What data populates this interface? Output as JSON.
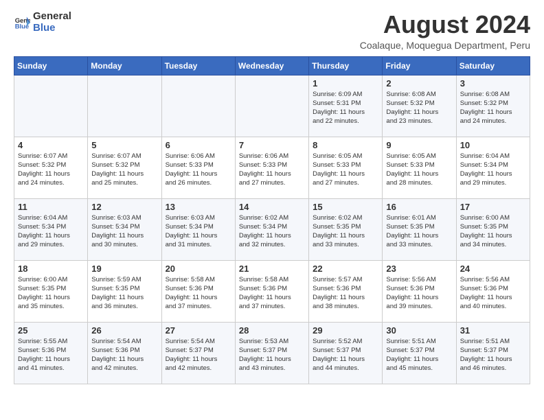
{
  "header": {
    "logo_general": "General",
    "logo_blue": "Blue",
    "title": "August 2024",
    "subtitle": "Coalaque, Moquegua Department, Peru"
  },
  "calendar": {
    "days_of_week": [
      "Sunday",
      "Monday",
      "Tuesday",
      "Wednesday",
      "Thursday",
      "Friday",
      "Saturday"
    ],
    "weeks": [
      [
        {
          "day": "",
          "info": ""
        },
        {
          "day": "",
          "info": ""
        },
        {
          "day": "",
          "info": ""
        },
        {
          "day": "",
          "info": ""
        },
        {
          "day": "1",
          "info": "Sunrise: 6:09 AM\nSunset: 5:31 PM\nDaylight: 11 hours\nand 22 minutes."
        },
        {
          "day": "2",
          "info": "Sunrise: 6:08 AM\nSunset: 5:32 PM\nDaylight: 11 hours\nand 23 minutes."
        },
        {
          "day": "3",
          "info": "Sunrise: 6:08 AM\nSunset: 5:32 PM\nDaylight: 11 hours\nand 24 minutes."
        }
      ],
      [
        {
          "day": "4",
          "info": "Sunrise: 6:07 AM\nSunset: 5:32 PM\nDaylight: 11 hours\nand 24 minutes."
        },
        {
          "day": "5",
          "info": "Sunrise: 6:07 AM\nSunset: 5:32 PM\nDaylight: 11 hours\nand 25 minutes."
        },
        {
          "day": "6",
          "info": "Sunrise: 6:06 AM\nSunset: 5:33 PM\nDaylight: 11 hours\nand 26 minutes."
        },
        {
          "day": "7",
          "info": "Sunrise: 6:06 AM\nSunset: 5:33 PM\nDaylight: 11 hours\nand 27 minutes."
        },
        {
          "day": "8",
          "info": "Sunrise: 6:05 AM\nSunset: 5:33 PM\nDaylight: 11 hours\nand 27 minutes."
        },
        {
          "day": "9",
          "info": "Sunrise: 6:05 AM\nSunset: 5:33 PM\nDaylight: 11 hours\nand 28 minutes."
        },
        {
          "day": "10",
          "info": "Sunrise: 6:04 AM\nSunset: 5:34 PM\nDaylight: 11 hours\nand 29 minutes."
        }
      ],
      [
        {
          "day": "11",
          "info": "Sunrise: 6:04 AM\nSunset: 5:34 PM\nDaylight: 11 hours\nand 29 minutes."
        },
        {
          "day": "12",
          "info": "Sunrise: 6:03 AM\nSunset: 5:34 PM\nDaylight: 11 hours\nand 30 minutes."
        },
        {
          "day": "13",
          "info": "Sunrise: 6:03 AM\nSunset: 5:34 PM\nDaylight: 11 hours\nand 31 minutes."
        },
        {
          "day": "14",
          "info": "Sunrise: 6:02 AM\nSunset: 5:34 PM\nDaylight: 11 hours\nand 32 minutes."
        },
        {
          "day": "15",
          "info": "Sunrise: 6:02 AM\nSunset: 5:35 PM\nDaylight: 11 hours\nand 33 minutes."
        },
        {
          "day": "16",
          "info": "Sunrise: 6:01 AM\nSunset: 5:35 PM\nDaylight: 11 hours\nand 33 minutes."
        },
        {
          "day": "17",
          "info": "Sunrise: 6:00 AM\nSunset: 5:35 PM\nDaylight: 11 hours\nand 34 minutes."
        }
      ],
      [
        {
          "day": "18",
          "info": "Sunrise: 6:00 AM\nSunset: 5:35 PM\nDaylight: 11 hours\nand 35 minutes."
        },
        {
          "day": "19",
          "info": "Sunrise: 5:59 AM\nSunset: 5:35 PM\nDaylight: 11 hours\nand 36 minutes."
        },
        {
          "day": "20",
          "info": "Sunrise: 5:58 AM\nSunset: 5:36 PM\nDaylight: 11 hours\nand 37 minutes."
        },
        {
          "day": "21",
          "info": "Sunrise: 5:58 AM\nSunset: 5:36 PM\nDaylight: 11 hours\nand 37 minutes."
        },
        {
          "day": "22",
          "info": "Sunrise: 5:57 AM\nSunset: 5:36 PM\nDaylight: 11 hours\nand 38 minutes."
        },
        {
          "day": "23",
          "info": "Sunrise: 5:56 AM\nSunset: 5:36 PM\nDaylight: 11 hours\nand 39 minutes."
        },
        {
          "day": "24",
          "info": "Sunrise: 5:56 AM\nSunset: 5:36 PM\nDaylight: 11 hours\nand 40 minutes."
        }
      ],
      [
        {
          "day": "25",
          "info": "Sunrise: 5:55 AM\nSunset: 5:36 PM\nDaylight: 11 hours\nand 41 minutes."
        },
        {
          "day": "26",
          "info": "Sunrise: 5:54 AM\nSunset: 5:36 PM\nDaylight: 11 hours\nand 42 minutes."
        },
        {
          "day": "27",
          "info": "Sunrise: 5:54 AM\nSunset: 5:37 PM\nDaylight: 11 hours\nand 42 minutes."
        },
        {
          "day": "28",
          "info": "Sunrise: 5:53 AM\nSunset: 5:37 PM\nDaylight: 11 hours\nand 43 minutes."
        },
        {
          "day": "29",
          "info": "Sunrise: 5:52 AM\nSunset: 5:37 PM\nDaylight: 11 hours\nand 44 minutes."
        },
        {
          "day": "30",
          "info": "Sunrise: 5:51 AM\nSunset: 5:37 PM\nDaylight: 11 hours\nand 45 minutes."
        },
        {
          "day": "31",
          "info": "Sunrise: 5:51 AM\nSunset: 5:37 PM\nDaylight: 11 hours\nand 46 minutes."
        }
      ]
    ]
  }
}
